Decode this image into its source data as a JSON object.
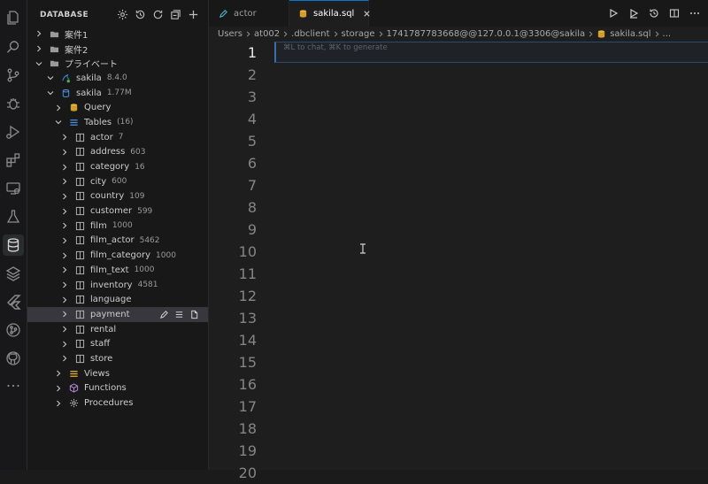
{
  "sidebar": {
    "title": "DATABASE",
    "items": [
      {
        "label": "案件1",
        "count": "",
        "depth": 0,
        "chevron": "right",
        "icon": "folder-icon",
        "name": "tree-folder-anken1"
      },
      {
        "label": "案件2",
        "count": "",
        "depth": 0,
        "chevron": "right",
        "icon": "folder-icon",
        "name": "tree-folder-anken2"
      },
      {
        "label": "プライベート",
        "count": "",
        "depth": 0,
        "chevron": "down",
        "icon": "folder-icon",
        "name": "tree-folder-private"
      },
      {
        "label": "sakila",
        "count": "8.4.0",
        "depth": 1,
        "chevron": "down",
        "icon": "mysql-connection-icon",
        "name": "tree-connection-sakila"
      },
      {
        "label": "sakila",
        "count": "1.77M",
        "depth": 2,
        "chevron": "down",
        "icon": "database-icon",
        "name": "tree-schema-sakila"
      },
      {
        "label": "Query",
        "count": "",
        "depth": 3,
        "chevron": "right",
        "icon": "query-stack-icon",
        "name": "tree-query"
      },
      {
        "label": "Tables",
        "count": "(16)",
        "depth": 3,
        "chevron": "down",
        "icon": "tables-list-icon",
        "name": "tree-tables"
      },
      {
        "label": "actor",
        "count": "7",
        "depth": 4,
        "chevron": "right",
        "icon": "table-icon",
        "name": "tree-table-actor"
      },
      {
        "label": "address",
        "count": "603",
        "depth": 4,
        "chevron": "right",
        "icon": "table-icon",
        "name": "tree-table-address"
      },
      {
        "label": "category",
        "count": "16",
        "depth": 4,
        "chevron": "right",
        "icon": "table-icon",
        "name": "tree-table-category"
      },
      {
        "label": "city",
        "count": "600",
        "depth": 4,
        "chevron": "right",
        "icon": "table-icon",
        "name": "tree-table-city"
      },
      {
        "label": "country",
        "count": "109",
        "depth": 4,
        "chevron": "right",
        "icon": "table-icon",
        "name": "tree-table-country"
      },
      {
        "label": "customer",
        "count": "599",
        "depth": 4,
        "chevron": "right",
        "icon": "table-icon",
        "name": "tree-table-customer"
      },
      {
        "label": "film",
        "count": "1000",
        "depth": 4,
        "chevron": "right",
        "icon": "table-icon",
        "name": "tree-table-film"
      },
      {
        "label": "film_actor",
        "count": "5462",
        "depth": 4,
        "chevron": "right",
        "icon": "table-icon",
        "name": "tree-table-film-actor"
      },
      {
        "label": "film_category",
        "count": "1000",
        "depth": 4,
        "chevron": "right",
        "icon": "table-icon",
        "name": "tree-table-film-category"
      },
      {
        "label": "film_text",
        "count": "1000",
        "depth": 4,
        "chevron": "right",
        "icon": "table-icon",
        "name": "tree-table-film-text"
      },
      {
        "label": "inventory",
        "count": "4581",
        "depth": 4,
        "chevron": "right",
        "icon": "table-icon",
        "name": "tree-table-inventory"
      },
      {
        "label": "language",
        "count": "",
        "depth": 4,
        "chevron": "right",
        "icon": "table-icon",
        "name": "tree-table-language"
      },
      {
        "label": "payment",
        "count": "",
        "depth": 4,
        "chevron": "right",
        "icon": "table-icon",
        "name": "tree-table-payment",
        "selected": true
      },
      {
        "label": "rental",
        "count": "",
        "depth": 4,
        "chevron": "right",
        "icon": "table-icon",
        "name": "tree-table-rental"
      },
      {
        "label": "staff",
        "count": "",
        "depth": 4,
        "chevron": "right",
        "icon": "table-icon",
        "name": "tree-table-staff"
      },
      {
        "label": "store",
        "count": "",
        "depth": 4,
        "chevron": "right",
        "icon": "table-icon",
        "name": "tree-table-store"
      },
      {
        "label": "Views",
        "count": "",
        "depth": 3,
        "chevron": "right",
        "icon": "views-stack-icon",
        "name": "tree-views"
      },
      {
        "label": "Functions",
        "count": "",
        "depth": 3,
        "chevron": "right",
        "icon": "cube-icon",
        "name": "tree-functions"
      },
      {
        "label": "Procedures",
        "count": "",
        "depth": 3,
        "chevron": "right",
        "icon": "gear-icon",
        "name": "tree-procedures"
      }
    ]
  },
  "tabs": [
    {
      "label": "actor",
      "active": false,
      "icon": "pencil-icon"
    },
    {
      "label": "sakila.sql",
      "active": true,
      "icon": "database-icon"
    }
  ],
  "breadcrumb": [
    "Users",
    "at002",
    ".dbclient",
    "storage",
    "1741787783668@@127.0.0.1@3306@sakila",
    "sakila.sql",
    "..."
  ],
  "editor": {
    "hint": "⌘L to chat, ⌘K to generate",
    "line_numbers": [
      "1",
      "2",
      "3",
      "4",
      "5",
      "6",
      "7",
      "8",
      "9",
      "10",
      "11",
      "12",
      "13",
      "14",
      "15",
      "16",
      "17",
      "18",
      "19",
      "20"
    ]
  },
  "colors": {
    "accent": "#0078d4",
    "table_icon": "#b9b9b9",
    "database_icon": "#e8b53a",
    "tables_icon": "#4a8fe0",
    "functions_icon": "#b084d6",
    "connection_dot": "#3fb950"
  }
}
